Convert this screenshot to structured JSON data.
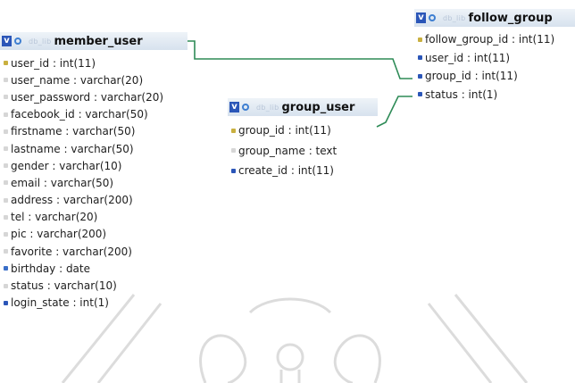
{
  "tables": {
    "member_user": {
      "db": "db_lib",
      "name": "member_user",
      "fields": [
        {
          "text": "user_id : int(11)",
          "kind": "pk"
        },
        {
          "text": "user_name : varchar(20)",
          "kind": "plain"
        },
        {
          "text": "user_password : varchar(20)",
          "kind": "plain"
        },
        {
          "text": "facebook_id : varchar(50)",
          "kind": "plain"
        },
        {
          "text": "firstname : varchar(50)",
          "kind": "plain"
        },
        {
          "text": "lastname : varchar(50)",
          "kind": "plain"
        },
        {
          "text": "gender : varchar(10)",
          "kind": "plain"
        },
        {
          "text": "email : varchar(50)",
          "kind": "plain"
        },
        {
          "text": "address : varchar(200)",
          "kind": "plain"
        },
        {
          "text": "tel : varchar(20)",
          "kind": "plain"
        },
        {
          "text": "pic : varchar(200)",
          "kind": "plain"
        },
        {
          "text": "favorite : varchar(200)",
          "kind": "plain"
        },
        {
          "text": "birthday : date",
          "kind": "cal"
        },
        {
          "text": "status : varchar(10)",
          "kind": "plain"
        },
        {
          "text": "login_state : int(1)",
          "kind": "fk"
        }
      ]
    },
    "group_user": {
      "db": "db_lib",
      "name": "group_user",
      "fields": [
        {
          "text": "group_id : int(11)",
          "kind": "pk"
        },
        {
          "text": "group_name : text",
          "kind": "plain"
        },
        {
          "text": "create_id : int(11)",
          "kind": "fk"
        }
      ]
    },
    "follow_group": {
      "db": "db_lib",
      "name": "follow_group",
      "fields": [
        {
          "text": "follow_group_id : int(11)",
          "kind": "pk"
        },
        {
          "text": "user_id : int(11)",
          "kind": "fk"
        },
        {
          "text": "group_id : int(11)",
          "kind": "fk"
        },
        {
          "text": "status : int(1)",
          "kind": "fk"
        }
      ]
    }
  },
  "colors": {
    "header_bg": "#dbe5f0",
    "relation_line": "#2e8b57",
    "v_badge": "#2b56b8",
    "watermark": "#d6d6d6"
  }
}
